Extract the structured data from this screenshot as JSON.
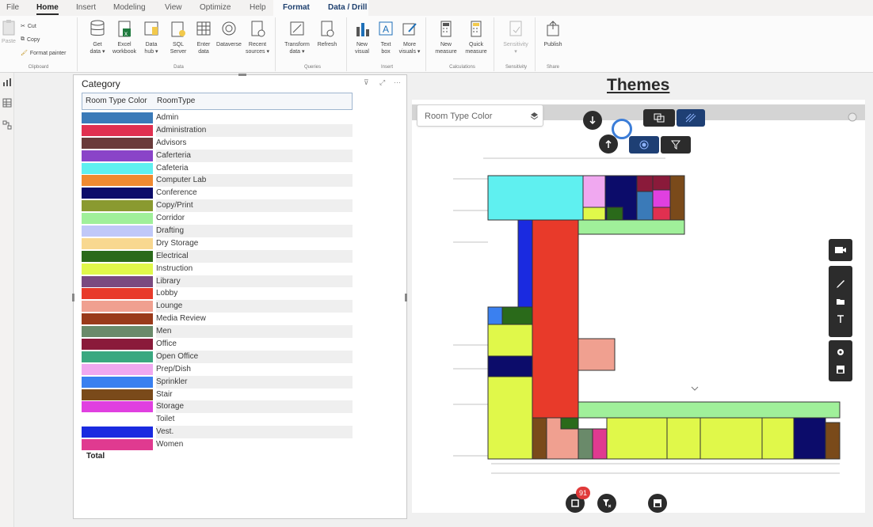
{
  "menu": {
    "tabs": [
      "File",
      "Home",
      "Insert",
      "Modeling",
      "View",
      "Optimize",
      "Help",
      "Format",
      "Data / Drill"
    ],
    "active": "Home"
  },
  "ribbon": {
    "clipboard": {
      "paste": "Paste",
      "cut": "Cut",
      "copy": "Copy",
      "format_painter": "Format painter",
      "label": "Clipboard"
    },
    "data": {
      "label": "Data",
      "buttons": [
        "Get\ndata ▾",
        "Excel\nworkbook",
        "Data\nhub ▾",
        "SQL\nServer",
        "Enter\ndata",
        "Dataverse",
        "Recent\nsources ▾"
      ]
    },
    "queries": {
      "label": "Queries",
      "buttons": [
        "Transform\ndata ▾",
        "Refresh"
      ]
    },
    "insert": {
      "label": "Insert",
      "buttons": [
        "New\nvisual",
        "Text\nbox",
        "More\nvisuals ▾"
      ]
    },
    "calculations": {
      "label": "Calculations",
      "buttons": [
        "New\nmeasure",
        "Quick\nmeasure"
      ]
    },
    "sensitivity": {
      "label": "Sensitivity",
      "buttons": [
        "Sensitivity\n▾"
      ]
    },
    "share": {
      "label": "Share",
      "buttons": [
        "Publish"
      ]
    }
  },
  "table": {
    "title": "Category",
    "col_color": "Room Type Color",
    "col_type": "RoomType",
    "rows": [
      {
        "name": "Admin",
        "color": "#3a7ab8"
      },
      {
        "name": "Administration",
        "color": "#e03050"
      },
      {
        "name": "Advisors",
        "color": "#6a3a3a"
      },
      {
        "name": "Caferteria",
        "color": "#8a44c8"
      },
      {
        "name": "Cafeteria",
        "color": "#5ff0f0"
      },
      {
        "name": "Computer Lab",
        "color": "#f08a30"
      },
      {
        "name": "Conference",
        "color": "#0c0c6a"
      },
      {
        "name": "Copy/Print",
        "color": "#8a9a30"
      },
      {
        "name": "Corridor",
        "color": "#a0f09a"
      },
      {
        "name": "Drafting",
        "color": "#c0c8f8"
      },
      {
        "name": "Dry Storage",
        "color": "#f8d890"
      },
      {
        "name": "Electrical",
        "color": "#2a6a1a"
      },
      {
        "name": "Instruction",
        "color": "#e0f84a"
      },
      {
        "name": "Library",
        "color": "#7a4a80"
      },
      {
        "name": "Lobby",
        "color": "#e83a2a"
      },
      {
        "name": "Lounge",
        "color": "#f0a090"
      },
      {
        "name": "Media Review",
        "color": "#9a3a1a"
      },
      {
        "name": "Men",
        "color": "#6a8a6a"
      },
      {
        "name": "Office",
        "color": "#8a1a3a"
      },
      {
        "name": "Open Office",
        "color": "#3aa880"
      },
      {
        "name": "Prep/Dish",
        "color": "#f0a8f0"
      },
      {
        "name": "Sprinkler",
        "color": "#3a80f0"
      },
      {
        "name": "Stair",
        "color": "#7a4a1a"
      },
      {
        "name": "Storage",
        "color": "#e040e0"
      },
      {
        "name": "Toilet",
        "color": "#ffffff"
      },
      {
        "name": "Vest.",
        "color": "#1a2ae0"
      },
      {
        "name": "Women",
        "color": "#e03a90"
      }
    ],
    "total_label": "Total"
  },
  "themes_title": "Themes",
  "floorplan": {
    "dropdown_label": "Room Type Color",
    "badge_count": "91"
  }
}
